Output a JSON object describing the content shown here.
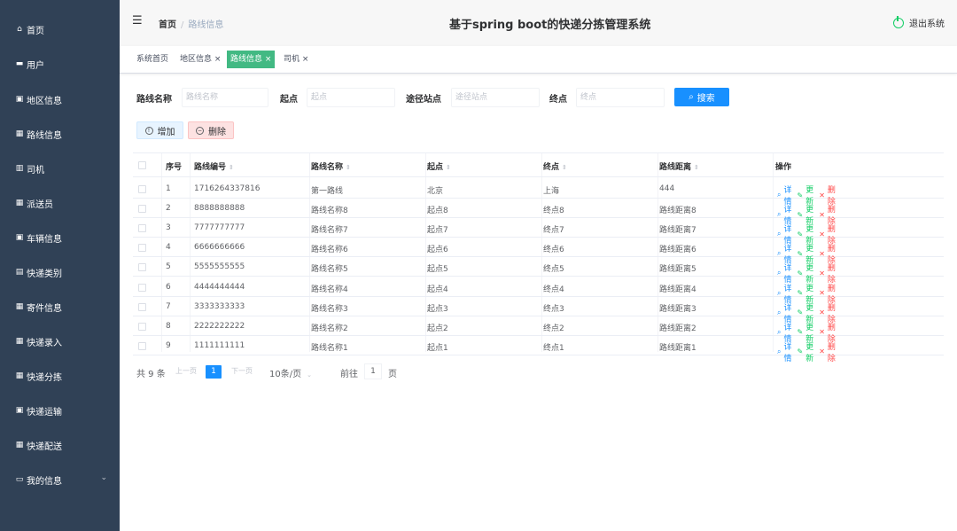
{
  "sidebar": {
    "items": [
      {
        "icon": "⌂",
        "label": "首页"
      },
      {
        "icon": "▬",
        "label": "用户"
      },
      {
        "icon": "▣",
        "label": "地区信息"
      },
      {
        "icon": "▦",
        "label": "路线信息"
      },
      {
        "icon": "▥",
        "label": "司机"
      },
      {
        "icon": "▦",
        "label": "派送员"
      },
      {
        "icon": "▣",
        "label": "车辆信息"
      },
      {
        "icon": "▤",
        "label": "快递类别"
      },
      {
        "icon": "▦",
        "label": "寄件信息"
      },
      {
        "icon": "▦",
        "label": "快递录入"
      },
      {
        "icon": "▦",
        "label": "快递分拣"
      },
      {
        "icon": "▣",
        "label": "快递运输"
      },
      {
        "icon": "▦",
        "label": "快递配送"
      },
      {
        "icon": "▭",
        "label": "我的信息"
      }
    ],
    "chevron": "⌄"
  },
  "header": {
    "menu_icon": "☰",
    "breadcrumb_home": "首页",
    "breadcrumb_sep": "/",
    "breadcrumb_current": "路线信息",
    "title": "基于spring boot的快递分拣管理系统",
    "logout_label": "退出系统"
  },
  "tags": [
    {
      "label": "系统首页"
    },
    {
      "label": "地区信息 ×"
    },
    {
      "label": "路线信息 ×"
    },
    {
      "label": "司机 ×"
    }
  ],
  "search": {
    "route_name_label": "路线名称",
    "route_name_placeholder": "路线名称",
    "start_label": "起点",
    "start_placeholder": "起点",
    "via_label": "途径站点",
    "via_placeholder": "途径站点",
    "end_label": "终点",
    "end_placeholder": "终点",
    "button_icon": "⌕",
    "button_label": "搜索"
  },
  "actions": {
    "add_icon": "!",
    "add_label": "增加",
    "delete_icon": "−",
    "delete_label": "删除"
  },
  "table": {
    "headers": [
      "序号",
      "路线编号",
      "路线名称",
      "起点",
      "终点",
      "路线距离",
      "操作"
    ],
    "sort_icon": "⇕",
    "rows": [
      [
        "1",
        "1716264337816",
        "第一路线",
        "北京",
        "上海",
        "444"
      ],
      [
        "2",
        "8888888888",
        "路线名称8",
        "起点8",
        "终点8",
        "路线距离8"
      ],
      [
        "3",
        "7777777777",
        "路线名称7",
        "起点7",
        "终点7",
        "路线距离7"
      ],
      [
        "4",
        "6666666666",
        "路线名称6",
        "起点6",
        "终点6",
        "路线距离6"
      ],
      [
        "5",
        "5555555555",
        "路线名称5",
        "起点5",
        "终点5",
        "路线距离5"
      ],
      [
        "6",
        "4444444444",
        "路线名称4",
        "起点4",
        "终点4",
        "路线距离4"
      ],
      [
        "7",
        "3333333333",
        "路线名称3",
        "起点3",
        "终点3",
        "路线距离3"
      ],
      [
        "8",
        "2222222222",
        "路线名称2",
        "起点2",
        "终点2",
        "路线距离2"
      ],
      [
        "9",
        "1111111111",
        "路线名称1",
        "起点1",
        "终点1",
        "路线距离1"
      ]
    ],
    "op_view": "详情",
    "op_edit": "更新",
    "op_delete": "删除",
    "op_view_icon": "⌕",
    "op_edit_icon": "✎",
    "op_delete_icon": "✕"
  },
  "pagination": {
    "total": "共 9 条",
    "prev": "上一页",
    "current": "1",
    "next": "下一页",
    "page_size": "10条/页",
    "size_arrow": "⌄",
    "goto": "前往",
    "goto_value": "1",
    "page_suffix": "页"
  },
  "colors": {
    "sidebar_bg": "#304156",
    "primary": "#1890ff",
    "active_tag": "#42b983",
    "success": "#13ce66",
    "danger": "#ff4949"
  }
}
